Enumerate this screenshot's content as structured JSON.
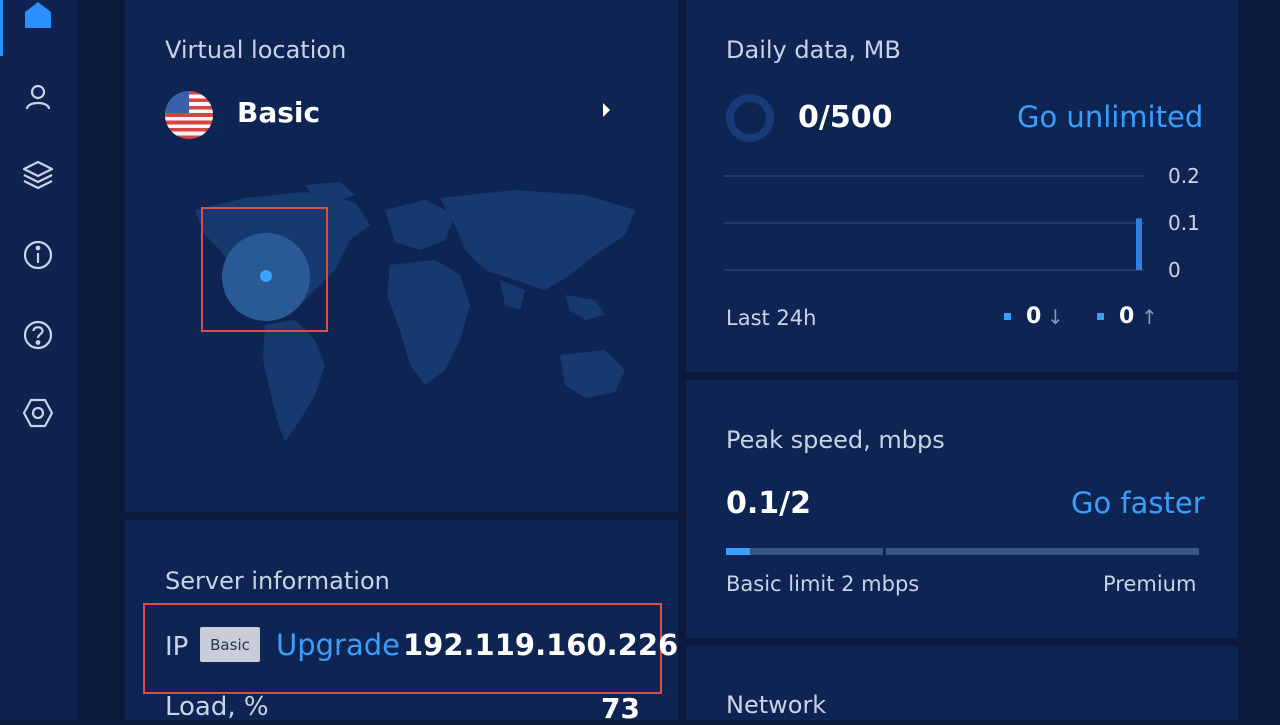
{
  "sidebar": {
    "items": [
      {
        "name": "home",
        "icon": "home-icon",
        "active": true
      },
      {
        "name": "account",
        "icon": "user-icon"
      },
      {
        "name": "layers",
        "icon": "layers-icon"
      },
      {
        "name": "info",
        "icon": "info-icon"
      },
      {
        "name": "help",
        "icon": "help-icon"
      },
      {
        "name": "settings",
        "icon": "settings-icon"
      }
    ]
  },
  "location": {
    "title": "Virtual location",
    "name": "Basic",
    "flag": "us-flag-icon"
  },
  "server": {
    "title": "Server information",
    "ip_label": "IP",
    "badge": "Basic",
    "upgrade_label": "Upgrade",
    "ip": "192.119.160.226",
    "load_label": "Load, %",
    "load_value": "73"
  },
  "data": {
    "title": "Daily data, MB",
    "usage": "0/500",
    "link": "Go unlimited",
    "period_label": "Last 24h",
    "download_value": "0",
    "upload_value": "0"
  },
  "speed": {
    "title": "Peak speed, mbps",
    "value": "0.1/2",
    "link": "Go faster",
    "limit_label": "Basic limit 2 mbps",
    "premium_label": "Premium",
    "progress_fraction": 0.05
  },
  "network": {
    "title": "Network"
  },
  "chart_data": {
    "type": "bar",
    "ylim": [
      0,
      0.2
    ],
    "yticks": [
      "0.2",
      "0.1",
      "0"
    ],
    "series": [
      {
        "values": [
          0.11
        ]
      }
    ],
    "grid": true
  },
  "colors": {
    "accent": "#3a9eff",
    "background": "#0b1a3c",
    "panel": "#0e2553",
    "highlight": "#e24a4a"
  }
}
